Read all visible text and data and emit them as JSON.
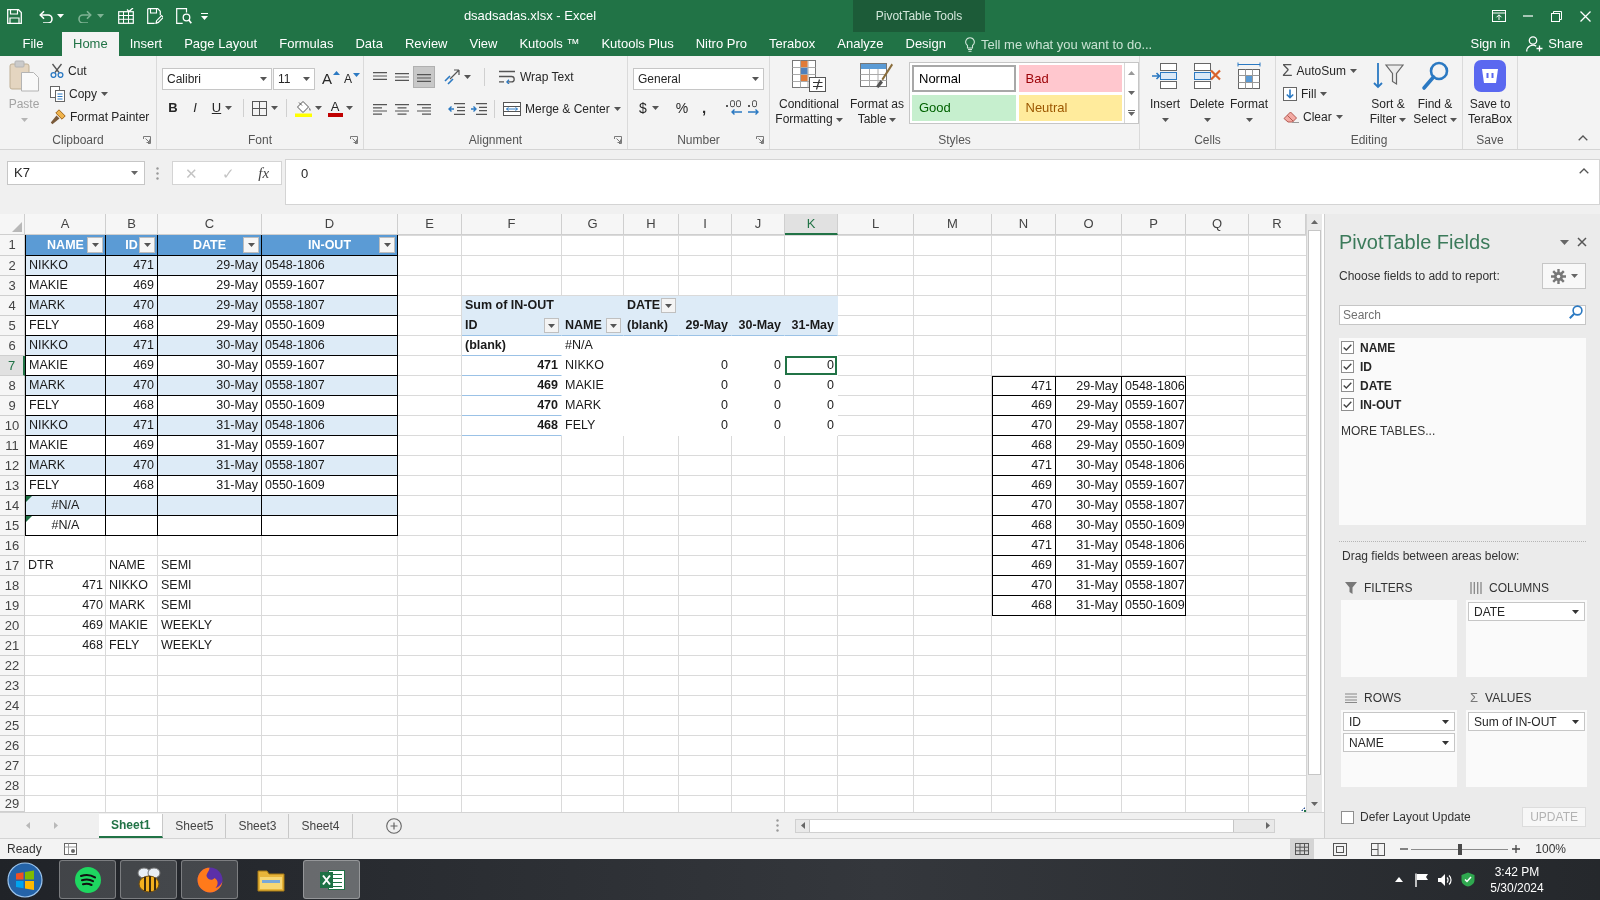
{
  "quick_access": [
    {
      "disabled": false
    },
    {
      "disabled": false
    },
    {
      "disabled": true
    },
    {
      "disabled": false
    },
    {
      "disabled": false
    },
    {
      "disabled": false
    }
  ],
  "window": {
    "title": "dsadsadas.xlsx - Excel",
    "tool_group": "PivotTable Tools"
  },
  "ribbon_tabs": [
    {
      "label": "File",
      "selected": false
    },
    {
      "label": "Home",
      "selected": true
    },
    {
      "label": "Insert",
      "selected": false
    },
    {
      "label": "Page Layout",
      "selected": false
    },
    {
      "label": "Formulas",
      "selected": false
    },
    {
      "label": "Data",
      "selected": false
    },
    {
      "label": "Review",
      "selected": false
    },
    {
      "label": "View",
      "selected": false
    },
    {
      "label": "Kutools ™",
      "selected": false
    },
    {
      "label": "Kutools Plus",
      "selected": false
    },
    {
      "label": "Nitro Pro",
      "selected": false
    },
    {
      "label": "Terabox",
      "selected": false
    },
    {
      "label": "Analyze",
      "selected": false
    },
    {
      "label": "Design",
      "selected": false
    }
  ],
  "tell_me": {
    "placeholder": "Tell me what you want to do..."
  },
  "account": {
    "sign_in": "Sign in",
    "share": "Share"
  },
  "ribbon": {
    "clipboard": {
      "label": "Clipboard",
      "launcher": true,
      "paste": {
        "label": "Paste",
        "disabled": true
      },
      "cut": "Cut",
      "copy": "Copy",
      "format_painter": "Format Painter"
    },
    "font": {
      "label": "Font",
      "launcher": true,
      "font_name": "Calibri",
      "font_size": "11",
      "grow": "A",
      "shrink": "A",
      "bold": "B",
      "italic": "I",
      "underline": "U",
      "font_color": "A"
    },
    "alignment": {
      "label": "Alignment",
      "launcher": true,
      "vertical": [
        {
          "selected": false
        },
        {
          "selected": false
        },
        {
          "selected": true
        }
      ],
      "wrap_text": "Wrap Text",
      "merge": "Merge & Center"
    },
    "number": {
      "label": "Number",
      "launcher": true,
      "format": "General",
      "currency": "$",
      "percent": "%",
      "comma": ","
    },
    "styles": {
      "label": "Styles",
      "conditional_formatting": "Conditional Formatting",
      "format_as_table": "Format as Table",
      "gallery": [
        {
          "label": "Normal",
          "kind": "normal",
          "selected": true
        },
        {
          "label": "Bad",
          "kind": "bad",
          "selected": false
        },
        {
          "label": "Good",
          "kind": "good",
          "selected": false
        },
        {
          "label": "Neutral",
          "kind": "neutral",
          "selected": false
        }
      ]
    },
    "cells": {
      "label": "Cells",
      "buttons": [
        "Insert",
        "Delete",
        "Format"
      ]
    },
    "editing": {
      "label": "Editing",
      "autosum_symbol": "Σ",
      "autosum": "AutoSum",
      "fill": "Fill",
      "clear": "Clear",
      "sort_filter": "Sort & Filter",
      "find_select": "Find & Select"
    },
    "save": {
      "label": "Save",
      "button": "Save to TeraBox"
    }
  },
  "formula_bar": {
    "name_box": "K7",
    "cancel": {
      "label": "✕",
      "disabled": true
    },
    "enter": {
      "label": "✓",
      "disabled": true
    },
    "insert_function": "fx",
    "formula": "0"
  },
  "sheet": {
    "columns": [
      {
        "label": "A",
        "selected": false
      },
      {
        "label": "B",
        "selected": false
      },
      {
        "label": "C",
        "selected": false
      },
      {
        "label": "D",
        "selected": false
      },
      {
        "label": "E",
        "selected": false
      },
      {
        "label": "F",
        "selected": false
      },
      {
        "label": "G",
        "selected": false
      },
      {
        "label": "H",
        "selected": false
      },
      {
        "label": "I",
        "selected": false
      },
      {
        "label": "J",
        "selected": false
      },
      {
        "label": "K",
        "selected": true
      },
      {
        "label": "L",
        "selected": false
      },
      {
        "label": "M",
        "selected": false
      },
      {
        "label": "N",
        "selected": false
      },
      {
        "label": "O",
        "selected": false
      },
      {
        "label": "P",
        "selected": false
      },
      {
        "label": "Q",
        "selected": false
      },
      {
        "label": "R",
        "selected": false
      }
    ],
    "rows": [
      {
        "label": "1",
        "selected": false
      },
      {
        "label": "2",
        "selected": false
      },
      {
        "label": "3",
        "selected": false
      },
      {
        "label": "4",
        "selected": false
      },
      {
        "label": "5",
        "selected": false
      },
      {
        "label": "6",
        "selected": false
      },
      {
        "label": "7",
        "selected": true
      },
      {
        "label": "8",
        "selected": false
      },
      {
        "label": "9",
        "selected": false
      },
      {
        "label": "10",
        "selected": false
      },
      {
        "label": "11",
        "selected": false
      },
      {
        "label": "12",
        "selected": false
      },
      {
        "label": "13",
        "selected": false
      },
      {
        "label": "14",
        "selected": false
      },
      {
        "label": "15",
        "selected": false
      },
      {
        "label": "16",
        "selected": false
      },
      {
        "label": "17",
        "selected": false
      },
      {
        "label": "18",
        "selected": false
      },
      {
        "label": "19",
        "selected": false
      },
      {
        "label": "20",
        "selected": false
      },
      {
        "label": "21",
        "selected": false
      },
      {
        "label": "22",
        "selected": false
      },
      {
        "label": "23",
        "selected": false
      },
      {
        "label": "24",
        "selected": false
      },
      {
        "label": "25",
        "selected": false
      },
      {
        "label": "26",
        "selected": false
      },
      {
        "label": "27",
        "selected": false
      },
      {
        "label": "28",
        "selected": false
      },
      {
        "label": "29",
        "selected": false
      }
    ]
  },
  "source_table": {
    "columns": [
      "NAME",
      "ID",
      "DATE",
      "IN-OUT"
    ],
    "rows": [
      {
        "name": "NIKKO",
        "id": "471",
        "date": "29-May",
        "in_out": "0548-1806",
        "error": false
      },
      {
        "name": "MAKIE",
        "id": "469",
        "date": "29-May",
        "in_out": "0559-1607",
        "error": false
      },
      {
        "name": "MARK",
        "id": "470",
        "date": "29-May",
        "in_out": "0558-1807",
        "error": false
      },
      {
        "name": "FELY",
        "id": "468",
        "date": "29-May",
        "in_out": "0550-1609",
        "error": false
      },
      {
        "name": "NIKKO",
        "id": "471",
        "date": "30-May",
        "in_out": "0548-1806",
        "error": false
      },
      {
        "name": "MAKIE",
        "id": "469",
        "date": "30-May",
        "in_out": "0559-1607",
        "error": false
      },
      {
        "name": "MARK",
        "id": "470",
        "date": "30-May",
        "in_out": "0558-1807",
        "error": false
      },
      {
        "name": "FELY",
        "id": "468",
        "date": "30-May",
        "in_out": "0550-1609",
        "error": false
      },
      {
        "name": "NIKKO",
        "id": "471",
        "date": "31-May",
        "in_out": "0548-1806",
        "error": false
      },
      {
        "name": "MAKIE",
        "id": "469",
        "date": "31-May",
        "in_out": "0559-1607",
        "error": false
      },
      {
        "name": "MARK",
        "id": "470",
        "date": "31-May",
        "in_out": "0558-1807",
        "error": false
      },
      {
        "name": "FELY",
        "id": "468",
        "date": "31-May",
        "in_out": "0550-1609",
        "error": false
      },
      {
        "name": "#N/A",
        "error": true
      },
      {
        "name": "#N/A",
        "error": true
      }
    ]
  },
  "dtr_list": {
    "header": [
      "DTR",
      "NAME",
      "SEMI"
    ],
    "rows": [
      [
        "471",
        "NIKKO",
        "SEMI"
      ],
      [
        "470",
        "MARK",
        "SEMI"
      ],
      [
        "469",
        "MAKIE",
        "WEEKLY"
      ],
      [
        "468",
        "FELY",
        "WEEKLY"
      ]
    ]
  },
  "pivot_table": {
    "value_field": "Sum of IN-OUT",
    "column_field": "DATE",
    "row_fields": [
      "ID",
      "NAME"
    ],
    "column_items": [
      "(blank)",
      "29-May",
      "30-May",
      "31-May"
    ],
    "rows": [
      {
        "kind": "blank",
        "id": "(blank)",
        "name": "#N/A"
      },
      {
        "kind": "item",
        "id": "471",
        "name": "NIKKO",
        "values": [
          {
            "text": "0",
            "selected": false
          },
          {
            "text": "0",
            "selected": false
          },
          {
            "text": "0",
            "selected": true
          }
        ]
      },
      {
        "kind": "item",
        "id": "469",
        "name": "MAKIE",
        "values": [
          {
            "text": "0",
            "selected": false
          },
          {
            "text": "0",
            "selected": false
          },
          {
            "text": "0",
            "selected": false
          }
        ]
      },
      {
        "kind": "item",
        "id": "470",
        "name": "MARK",
        "values": [
          {
            "text": "0",
            "selected": false
          },
          {
            "text": "0",
            "selected": false
          },
          {
            "text": "0",
            "selected": false
          }
        ]
      },
      {
        "kind": "item",
        "id": "468",
        "name": "FELY",
        "values": [
          {
            "text": "0",
            "selected": false
          },
          {
            "text": "0",
            "selected": false
          },
          {
            "text": "0",
            "selected": false
          }
        ]
      }
    ]
  },
  "copied_range": {
    "rows": [
      [
        "471",
        "29-May",
        "0548-1806"
      ],
      [
        "469",
        "29-May",
        "0559-1607"
      ],
      [
        "470",
        "29-May",
        "0558-1807"
      ],
      [
        "468",
        "29-May",
        "0550-1609"
      ],
      [
        "471",
        "30-May",
        "0548-1806"
      ],
      [
        "469",
        "30-May",
        "0559-1607"
      ],
      [
        "470",
        "30-May",
        "0558-1807"
      ],
      [
        "468",
        "30-May",
        "0550-1609"
      ],
      [
        "471",
        "31-May",
        "0548-1806"
      ],
      [
        "469",
        "31-May",
        "0559-1607"
      ],
      [
        "470",
        "31-May",
        "0558-1807"
      ],
      [
        "468",
        "31-May",
        "0550-1609"
      ]
    ]
  },
  "sheet_tabs": [
    {
      "label": "Sheet1",
      "selected": true
    },
    {
      "label": "Sheet5",
      "selected": false
    },
    {
      "label": "Sheet3",
      "selected": false
    },
    {
      "label": "Sheet4",
      "selected": false
    }
  ],
  "pivot_pane": {
    "title": "PivotTable Fields",
    "prompt": "Choose fields to add to report:",
    "search": {
      "placeholder": "Search"
    },
    "fields": [
      {
        "label": "NAME",
        "checked": true
      },
      {
        "label": "ID",
        "checked": true
      },
      {
        "label": "DATE",
        "checked": true
      },
      {
        "label": "IN-OUT",
        "checked": true
      }
    ],
    "more_tables": "MORE TABLES...",
    "areas_prompt": "Drag fields between areas below:",
    "areas": [
      {
        "label": "FILTERS"
      },
      {
        "label": "COLUMNS",
        "items": [
          "DATE"
        ]
      },
      {
        "label": "ROWS",
        "items": [
          "ID",
          "NAME"
        ]
      },
      {
        "label": "VALUES",
        "symbol": "Σ",
        "items": [
          "Sum of IN-OUT"
        ]
      }
    ],
    "defer_update": {
      "label": "Defer Layout Update",
      "checked": false
    },
    "update_button": {
      "label": "UPDATE",
      "disabled": true
    }
  },
  "status_bar": {
    "status": "Ready",
    "views": [
      {
        "selected": true
      },
      {
        "selected": false
      },
      {
        "selected": false
      }
    ],
    "zoom": {
      "level": 0.5,
      "reading": "100%"
    }
  },
  "taskbar": {
    "apps": [
      {
        "running": true,
        "selected": false
      },
      {
        "running": true,
        "selected": false
      },
      {
        "running": true,
        "selected": false
      },
      {
        "running": false,
        "selected": false
      },
      {
        "running": true,
        "selected": true
      }
    ],
    "time": "3:42 PM",
    "date": "5/30/2024"
  }
}
